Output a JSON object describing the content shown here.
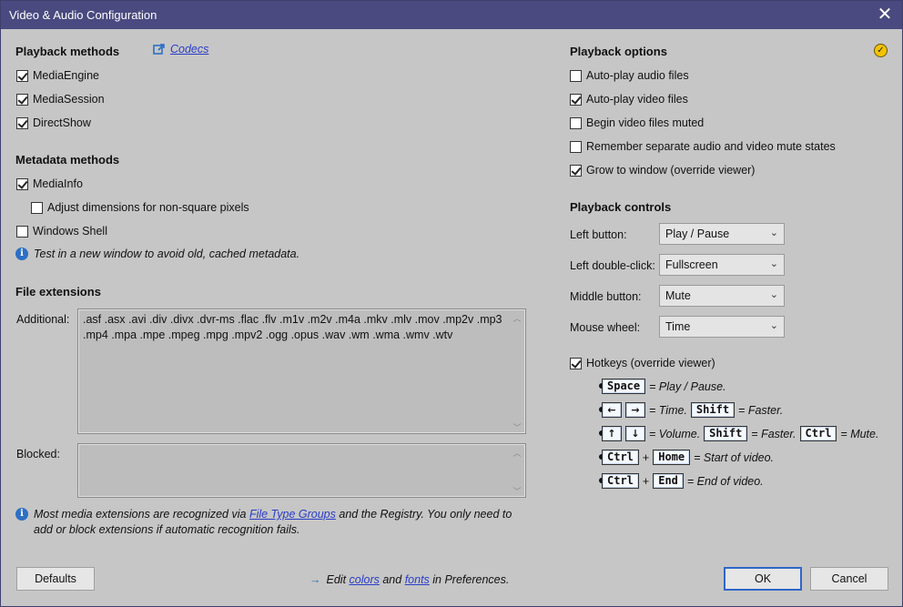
{
  "window": {
    "title": "Video & Audio Configuration"
  },
  "playback_methods": {
    "heading": "Playback methods",
    "codecs_link": "Codecs",
    "items": [
      {
        "label": "MediaEngine",
        "checked": true
      },
      {
        "label": "MediaSession",
        "checked": true
      },
      {
        "label": "DirectShow",
        "checked": true
      }
    ]
  },
  "metadata_methods": {
    "heading": "Metadata methods",
    "mediainfo": {
      "label": "MediaInfo",
      "checked": true
    },
    "adjust": {
      "label": "Adjust dimensions for non-square pixels",
      "checked": false
    },
    "windows_shell": {
      "label": "Windows Shell",
      "checked": false
    },
    "note": "Test in a new window to avoid old, cached metadata."
  },
  "file_extensions": {
    "heading": "File extensions",
    "additional_label": "Additional:",
    "additional_value": ".asf .asx .avi .div .divx .dvr-ms .flac .flv .m1v .m2v .m4a .mkv .mlv .mov .mp2v .mp3 .mp4 .mpa .mpe .mpeg .mpg .mpv2 .ogg .opus .wav .wm .wma .wmv .wtv",
    "blocked_label": "Blocked:",
    "blocked_value": "",
    "note_prefix": "Most media extensions are recognized via ",
    "note_link": "File Type Groups",
    "note_suffix": " and the Registry. You only need to",
    "note_line2": "add or block extensions if automatic recognition fails."
  },
  "playback_options": {
    "heading": "Playback options",
    "items": [
      {
        "label": "Auto-play audio files",
        "checked": false
      },
      {
        "label": "Auto-play video files",
        "checked": true
      },
      {
        "label": "Begin video files muted",
        "checked": false
      },
      {
        "label": "Remember separate audio and video mute states",
        "checked": false
      },
      {
        "label": "Grow to window (override viewer)",
        "checked": true
      }
    ]
  },
  "playback_controls": {
    "heading": "Playback controls",
    "rows": [
      {
        "label": "Left button:",
        "value": "Play / Pause"
      },
      {
        "label": "Left double-click:",
        "value": "Fullscreen"
      },
      {
        "label": "Middle button:",
        "value": "Mute"
      },
      {
        "label": "Mouse wheel:",
        "value": "Time"
      }
    ],
    "hotkeys": {
      "label": "Hotkeys (override viewer)",
      "checked": true
    }
  },
  "hotkeys": {
    "space": "Space",
    "play_pause": "= Play / Pause.",
    "left": "←",
    "right": "→",
    "time": "= Time.",
    "shift": "Shift",
    "faster": "= Faster.",
    "up": "↑",
    "down": "↓",
    "volume": "= Volume.",
    "ctrl": "Ctrl",
    "mute": "= Mute.",
    "plus": "+",
    "home": "Home",
    "start": "= Start of video.",
    "end": "End",
    "end_desc": "= End of video."
  },
  "footer": {
    "defaults": "Defaults",
    "edit_prefix": "Edit ",
    "colors": "colors",
    "and": " and ",
    "fonts": "fonts",
    "edit_suffix": " in Preferences.",
    "ok": "OK",
    "cancel": "Cancel"
  }
}
